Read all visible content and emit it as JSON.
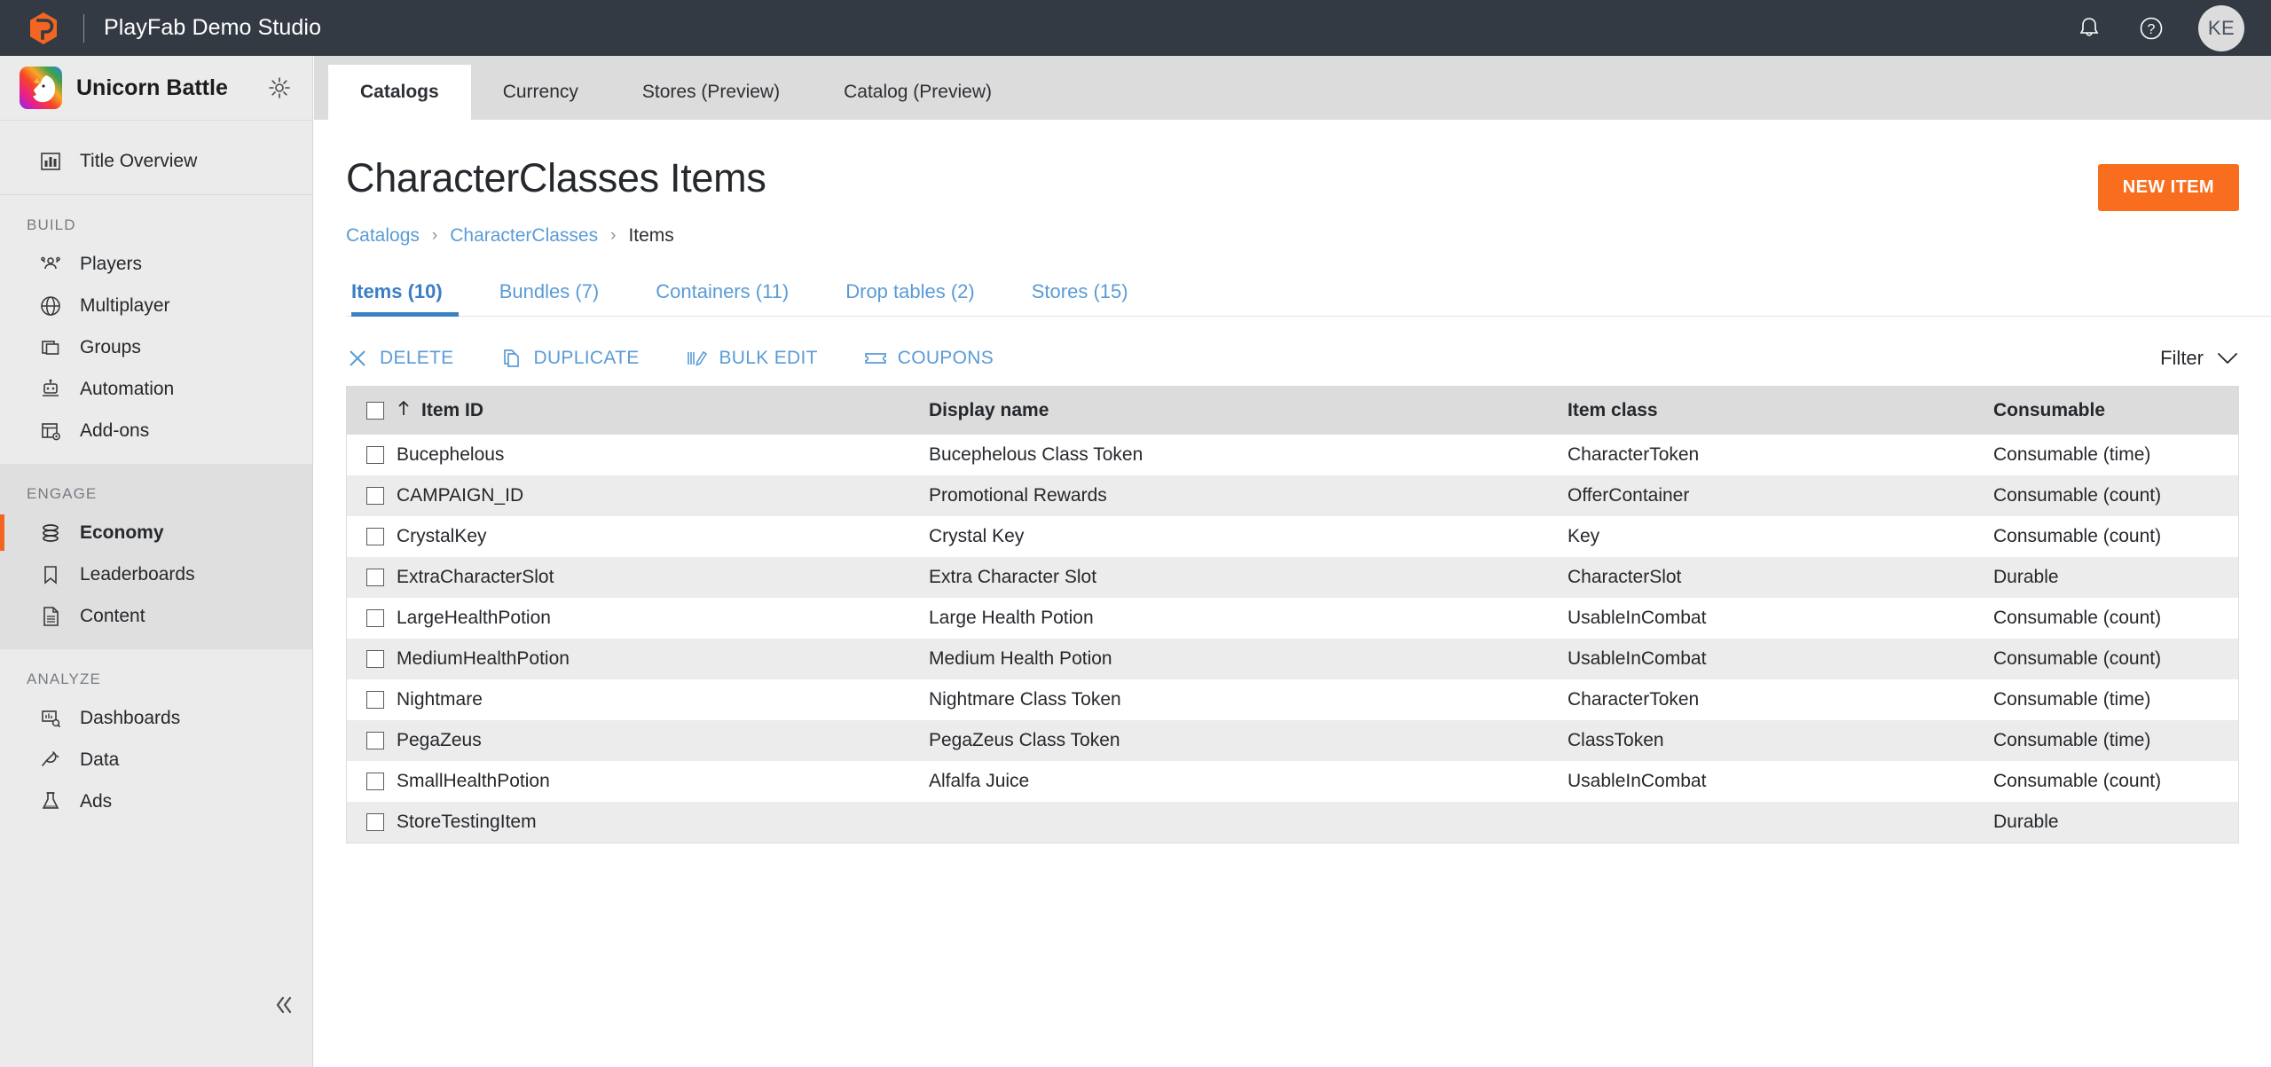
{
  "topbar": {
    "product_title": "PlayFab Demo Studio",
    "logo_icon": "playfab-hex-logo",
    "notification_icon": "bell-icon",
    "help_icon": "help-circle-icon",
    "avatar_initials": "KE",
    "accent_orange": "#f26522",
    "bar_color": "#343a44"
  },
  "sidebar": {
    "studio_name": "Unicorn Battle",
    "studio_avatar_icon": "unicorn-avatar",
    "settings_icon": "gear-icon",
    "collapse_icon": "chevron-double-left-icon",
    "top_item": {
      "label": "Title Overview",
      "icon": "bar-chart-icon"
    },
    "sections": [
      {
        "label": "BUILD",
        "items": [
          {
            "label": "Players",
            "icon": "people-icon",
            "active": false
          },
          {
            "label": "Multiplayer",
            "icon": "globe-icon",
            "active": false
          },
          {
            "label": "Groups",
            "icon": "stacked-squares-icon",
            "active": false
          },
          {
            "label": "Automation",
            "icon": "robot-icon",
            "active": false
          },
          {
            "label": "Add-ons",
            "icon": "addons-grid-icon",
            "active": false
          }
        ]
      },
      {
        "label": "ENGAGE",
        "items": [
          {
            "label": "Economy",
            "icon": "coins-stack-icon",
            "active": true
          },
          {
            "label": "Leaderboards",
            "icon": "bookmark-icon",
            "active": false
          },
          {
            "label": "Content",
            "icon": "document-icon",
            "active": false
          }
        ]
      },
      {
        "label": "ANALYZE",
        "items": [
          {
            "label": "Dashboards",
            "icon": "dashboard-search-icon",
            "active": false
          },
          {
            "label": "Data",
            "icon": "plug-icon",
            "active": false
          },
          {
            "label": "Ads",
            "icon": "flask-icon",
            "active": false
          }
        ]
      }
    ]
  },
  "main": {
    "tabs": [
      {
        "label": "Catalogs",
        "active": true
      },
      {
        "label": "Currency",
        "active": false
      },
      {
        "label": "Stores (Preview)",
        "active": false
      },
      {
        "label": "Catalog (Preview)",
        "active": false
      }
    ],
    "page_title": "CharacterClasses Items",
    "new_item_label": "NEW ITEM",
    "breadcrumb": [
      {
        "label": "Catalogs",
        "link": true
      },
      {
        "label": "CharacterClasses",
        "link": true
      },
      {
        "label": "Items",
        "link": false
      }
    ],
    "breadcrumb_separator": "›",
    "subtabs": [
      {
        "label": "Items (10)",
        "active": true
      },
      {
        "label": "Bundles (7)",
        "active": false
      },
      {
        "label": "Containers (11)",
        "active": false
      },
      {
        "label": "Drop tables (2)",
        "active": false
      },
      {
        "label": "Stores (15)",
        "active": false
      }
    ],
    "toolbar": [
      {
        "label": "DELETE",
        "icon": "x-close-icon"
      },
      {
        "label": "DUPLICATE",
        "icon": "copy-pages-icon"
      },
      {
        "label": "BULK EDIT",
        "icon": "pencil-edit-icon"
      },
      {
        "label": "COUPONS",
        "icon": "ticket-icon"
      }
    ],
    "filter": {
      "label": "Filter",
      "icon": "chevron-down-icon"
    }
  },
  "table": {
    "sort_column": "Item ID",
    "sort_direction_icon": "arrow-up-icon",
    "columns": [
      "Item ID",
      "Display name",
      "Item class",
      "Consumable"
    ],
    "rows": [
      {
        "item_id": "Bucephelous",
        "display_name": "Bucephelous Class Token",
        "item_class": "CharacterToken",
        "consumable": "Consumable (time)"
      },
      {
        "item_id": "CAMPAIGN_ID",
        "display_name": "Promotional Rewards",
        "item_class": "OfferContainer",
        "consumable": "Consumable (count)"
      },
      {
        "item_id": "CrystalKey",
        "display_name": "Crystal Key",
        "item_class": "Key",
        "consumable": "Consumable (count)"
      },
      {
        "item_id": "ExtraCharacterSlot",
        "display_name": "Extra Character Slot",
        "item_class": "CharacterSlot",
        "consumable": "Durable"
      },
      {
        "item_id": "LargeHealthPotion",
        "display_name": "Large Health Potion",
        "item_class": "UsableInCombat",
        "consumable": "Consumable (count)"
      },
      {
        "item_id": "MediumHealthPotion",
        "display_name": "Medium Health Potion",
        "item_class": "UsableInCombat",
        "consumable": "Consumable (count)"
      },
      {
        "item_id": "Nightmare",
        "display_name": "Nightmare Class Token",
        "item_class": "CharacterToken",
        "consumable": "Consumable (time)"
      },
      {
        "item_id": "PegaZeus",
        "display_name": "PegaZeus Class Token",
        "item_class": "ClassToken",
        "consumable": "Consumable (time)"
      },
      {
        "item_id": "SmallHealthPotion",
        "display_name": "Alfalfa Juice",
        "item_class": "UsableInCombat",
        "consumable": "Consumable (count)"
      },
      {
        "item_id": "StoreTestingItem",
        "display_name": "",
        "item_class": "",
        "consumable": "Durable"
      }
    ]
  }
}
